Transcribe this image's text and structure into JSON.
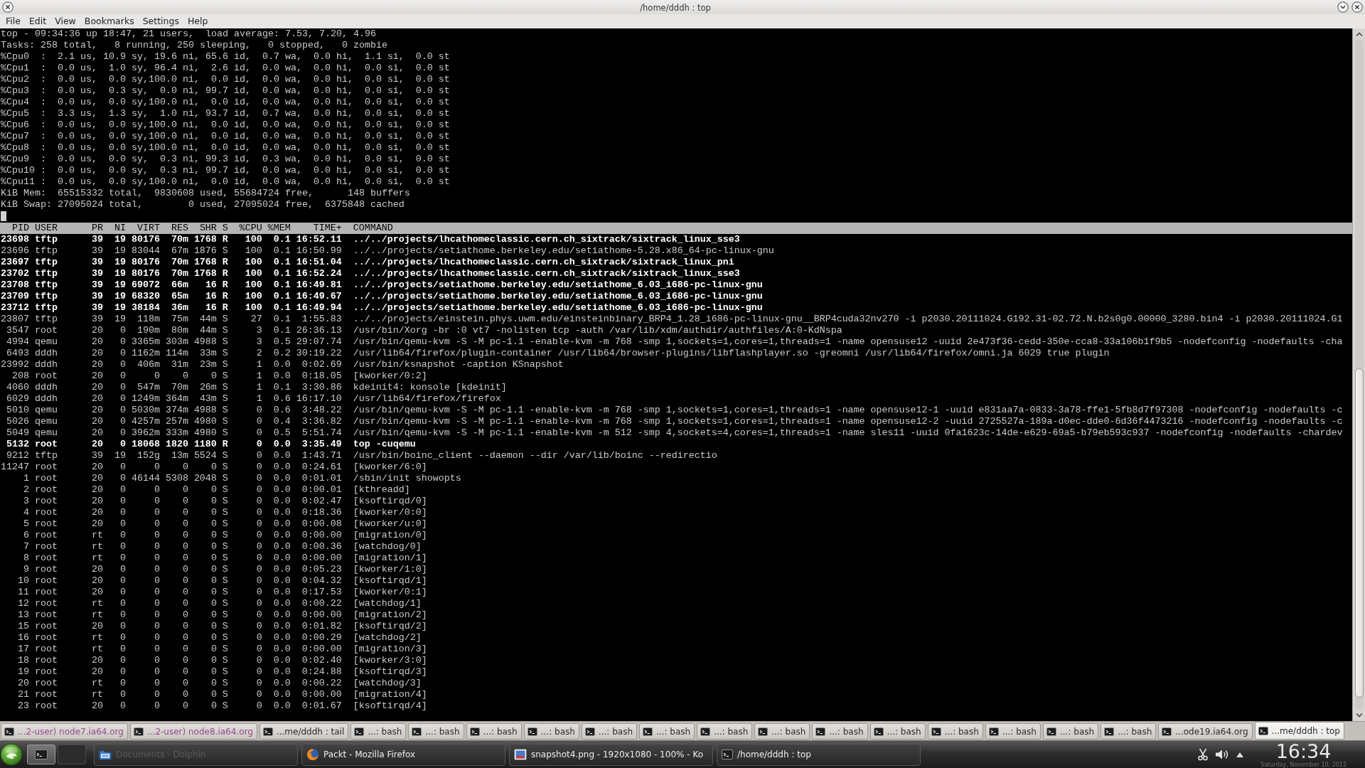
{
  "window": {
    "title": "/home/dddh : top"
  },
  "menu": [
    "File",
    "Edit",
    "View",
    "Bookmarks",
    "Settings",
    "Help"
  ],
  "terminal": {
    "summary": [
      "top - 09:34:36 up 18:47, 21 users,  load average: 7.53, 7.20, 4.96",
      "Tasks: 258 total,   8 running, 250 sleeping,   0 stopped,   0 zombie",
      "%Cpu0  :  2.1 us, 10.9 sy, 19.6 ni, 65.6 id,  0.7 wa,  0.0 hi,  1.1 si,  0.0 st",
      "%Cpu1  :  0.0 us,  1.0 sy, 96.4 ni,  2.6 id,  0.0 wa,  0.0 hi,  0.0 si,  0.0 st",
      "%Cpu2  :  0.0 us,  0.0 sy,100.0 ni,  0.0 id,  0.0 wa,  0.0 hi,  0.0 si,  0.0 st",
      "%Cpu3  :  0.0 us,  0.3 sy,  0.0 ni, 99.7 id,  0.0 wa,  0.0 hi,  0.0 si,  0.0 st",
      "%Cpu4  :  0.0 us,  0.0 sy,100.0 ni,  0.0 id,  0.0 wa,  0.0 hi,  0.0 si,  0.0 st",
      "%Cpu5  :  3.3 us,  1.3 sy,  1.0 ni, 93.7 id,  0.7 wa,  0.0 hi,  0.0 si,  0.0 st",
      "%Cpu6  :  0.0 us,  0.0 sy,100.0 ni,  0.0 id,  0.0 wa,  0.0 hi,  0.0 si,  0.0 st",
      "%Cpu7  :  0.0 us,  0.0 sy,100.0 ni,  0.0 id,  0.0 wa,  0.0 hi,  0.0 si,  0.0 st",
      "%Cpu8  :  0.0 us,  0.0 sy,100.0 ni,  0.0 id,  0.0 wa,  0.0 hi,  0.0 si,  0.0 st",
      "%Cpu9  :  0.0 us,  0.0 sy,  0.3 ni, 99.3 id,  0.3 wa,  0.0 hi,  0.0 si,  0.0 st",
      "%Cpu10 :  0.0 us,  0.0 sy,  0.3 ni, 99.7 id,  0.0 wa,  0.0 hi,  0.0 si,  0.0 st",
      "%Cpu11 :  0.0 us,  0.0 sy,100.0 ni,  0.0 id,  0.0 wa,  0.0 hi,  0.0 si,  0.0 st",
      "KiB Mem:  65515332 total,  9830608 used, 55684724 free,      148 buffers",
      "KiB Swap: 27095024 total,        0 used, 27095024 free,  6375848 cached"
    ],
    "columns": [
      "PID",
      "USER",
      "PR",
      "NI",
      "VIRT",
      "RES",
      "SHR",
      "S",
      "%CPU",
      "%MEM",
      "TIME+",
      "COMMAND"
    ],
    "processes": [
      {
        "pid": "23698",
        "user": "tftp",
        "priority": "39",
        "nice": "19",
        "virt": "80176",
        "res": "70m",
        "shr": "1768",
        "state": "R",
        "cpu": "100",
        "mem": "0.1",
        "time": "16:52.11",
        "command": "../../projects/lhcathomeclassic.cern.ch_sixtrack/sixtrack_linux_sse3",
        "highlighted": true
      },
      {
        "pid": "23696",
        "user": "tftp",
        "priority": "39",
        "nice": "19",
        "virt": "83044",
        "res": "67m",
        "shr": "1876",
        "state": "S",
        "cpu": "100",
        "mem": "0.1",
        "time": "16:50.99",
        "command": "../../projects/setiathome.berkeley.edu/setiathome-5.28.x86_64-pc-linux-gnu",
        "highlighted": false
      },
      {
        "pid": "23697",
        "user": "tftp",
        "priority": "39",
        "nice": "19",
        "virt": "80176",
        "res": "70m",
        "shr": "1768",
        "state": "R",
        "cpu": "100",
        "mem": "0.1",
        "time": "16:51.04",
        "command": "../../projects/lhcathomeclassic.cern.ch_sixtrack/sixtrack_linux_pni",
        "highlighted": true
      },
      {
        "pid": "23702",
        "user": "tftp",
        "priority": "39",
        "nice": "19",
        "virt": "80176",
        "res": "70m",
        "shr": "1768",
        "state": "R",
        "cpu": "100",
        "mem": "0.1",
        "time": "16:52.24",
        "command": "../../projects/lhcathomeclassic.cern.ch_sixtrack/sixtrack_linux_sse3",
        "highlighted": true
      },
      {
        "pid": "23708",
        "user": "tftp",
        "priority": "39",
        "nice": "19",
        "virt": "69072",
        "res": "66m",
        "shr": "16",
        "state": "R",
        "cpu": "100",
        "mem": "0.1",
        "time": "16:49.81",
        "command": "../../projects/setiathome.berkeley.edu/setiathome_6.03_i686-pc-linux-gnu",
        "highlighted": true
      },
      {
        "pid": "23709",
        "user": "tftp",
        "priority": "39",
        "nice": "19",
        "virt": "68320",
        "res": "65m",
        "shr": "16",
        "state": "R",
        "cpu": "100",
        "mem": "0.1",
        "time": "16:49.67",
        "command": "../../projects/setiathome.berkeley.edu/setiathome_6.03_i686-pc-linux-gnu",
        "highlighted": true
      },
      {
        "pid": "23712",
        "user": "tftp",
        "priority": "39",
        "nice": "19",
        "virt": "38184",
        "res": "36m",
        "shr": "16",
        "state": "R",
        "cpu": "100",
        "mem": "0.1",
        "time": "16:49.94",
        "command": "../../projects/setiathome.berkeley.edu/setiathome_6.03_i686-pc-linux-gnu",
        "highlighted": true
      },
      {
        "pid": "23807",
        "user": "tftp",
        "priority": "39",
        "nice": "19",
        "virt": "118m",
        "res": "75m",
        "shr": "44m",
        "state": "S",
        "cpu": "27",
        "mem": "0.1",
        "time": "1:55.83",
        "command": "../../projects/einstein.phys.uwm.edu/einsteinbinary_BRP4_1.28_i686-pc-linux-gnu__BRP4cuda32nv270 -i p2030.20111024.G192.31-02.72.N.b2s0g0.00000_3280.bin4 -i p2030.20111024.G1",
        "highlighted": false
      },
      {
        "pid": "3547",
        "user": "root",
        "priority": "20",
        "nice": "0",
        "virt": "190m",
        "res": "80m",
        "shr": "44m",
        "state": "S",
        "cpu": "3",
        "mem": "0.1",
        "time": "26:36.13",
        "command": "/usr/bin/Xorg -br :0 vt7 -nolisten tcp -auth /var/lib/xdm/authdir/authfiles/A:0-KdNspa",
        "highlighted": false
      },
      {
        "pid": "4994",
        "user": "qemu",
        "priority": "20",
        "nice": "0",
        "virt": "3365m",
        "res": "303m",
        "shr": "4988",
        "state": "S",
        "cpu": "3",
        "mem": "0.5",
        "time": "29:07.74",
        "command": "/usr/bin/qemu-kvm -S -M pc-1.1 -enable-kvm -m 768 -smp 1,sockets=1,cores=1,threads=1 -name opensuse12 -uuid 2e473f36-cedd-350e-cca8-33a106b1f9b5 -nodefconfig -nodefaults -cha",
        "highlighted": false
      },
      {
        "pid": "6493",
        "user": "dddh",
        "priority": "20",
        "nice": "0",
        "virt": "1162m",
        "res": "114m",
        "shr": "33m",
        "state": "S",
        "cpu": "2",
        "mem": "0.2",
        "time": "30:19.22",
        "command": "/usr/lib64/firefox/plugin-container /usr/lib64/browser-plugins/libflashplayer.so -greomni /usr/lib64/firefox/omni.ja 6029 true plugin",
        "highlighted": false
      },
      {
        "pid": "23992",
        "user": "dddh",
        "priority": "20",
        "nice": "0",
        "virt": "406m",
        "res": "31m",
        "shr": "23m",
        "state": "S",
        "cpu": "1",
        "mem": "0.0",
        "time": "0:02.69",
        "command": "/usr/bin/ksnapshot -caption KSnapshot",
        "highlighted": false
      },
      {
        "pid": "208",
        "user": "root",
        "priority": "20",
        "nice": "0",
        "virt": "0",
        "res": "0",
        "shr": "0",
        "state": "S",
        "cpu": "1",
        "mem": "0.0",
        "time": "0:18.05",
        "command": "[kworker/0:2]",
        "highlighted": false
      },
      {
        "pid": "4060",
        "user": "dddh",
        "priority": "20",
        "nice": "0",
        "virt": "547m",
        "res": "70m",
        "shr": "26m",
        "state": "S",
        "cpu": "1",
        "mem": "0.1",
        "time": "3:30.86",
        "command": "kdeinit4: konsole [kdeinit]",
        "highlighted": false
      },
      {
        "pid": "6029",
        "user": "dddh",
        "priority": "20",
        "nice": "0",
        "virt": "1249m",
        "res": "364m",
        "shr": "43m",
        "state": "S",
        "cpu": "1",
        "mem": "0.6",
        "time": "16:17.10",
        "command": "/usr/lib64/firefox/firefox",
        "highlighted": false
      },
      {
        "pid": "5010",
        "user": "qemu",
        "priority": "20",
        "nice": "0",
        "virt": "5030m",
        "res": "374m",
        "shr": "4988",
        "state": "S",
        "cpu": "0",
        "mem": "0.6",
        "time": "3:48.22",
        "command": "/usr/bin/qemu-kvm -S -M pc-1.1 -enable-kvm -m 768 -smp 1,sockets=1,cores=1,threads=1 -name opensuse12-1 -uuid e831aa7a-0833-3a78-ffe1-5fb8d7f97308 -nodefconfig -nodefaults -c",
        "highlighted": false
      },
      {
        "pid": "5026",
        "user": "qemu",
        "priority": "20",
        "nice": "0",
        "virt": "4257m",
        "res": "257m",
        "shr": "4980",
        "state": "S",
        "cpu": "0",
        "mem": "0.4",
        "time": "3:36.82",
        "command": "/usr/bin/qemu-kvm -S -M pc-1.1 -enable-kvm -m 768 -smp 1,sockets=1,cores=1,threads=1 -name opensuse12-2 -uuid 2725527a-189a-d0ec-dde0-6d36f4473216 -nodefconfig -nodefaults -c",
        "highlighted": false
      },
      {
        "pid": "5049",
        "user": "qemu",
        "priority": "20",
        "nice": "0",
        "virt": "3962m",
        "res": "333m",
        "shr": "4980",
        "state": "S",
        "cpu": "0",
        "mem": "0.5",
        "time": "5:51.74",
        "command": "/usr/bin/qemu-kvm -S -M pc-1.1 -enable-kvm -m 512 -smp 4,sockets=4,cores=1,threads=1 -name sles11 -uuid 0fa1623c-14de-e629-69a5-b79eb593c937 -nodefconfig -nodefaults -chardev",
        "highlighted": false
      },
      {
        "pid": "5132",
        "user": "root",
        "priority": "20",
        "nice": "0",
        "virt": "18068",
        "res": "1820",
        "shr": "1180",
        "state": "R",
        "cpu": "0",
        "mem": "0.0",
        "time": "3:35.49",
        "command": "top -cuqemu",
        "highlighted": true
      },
      {
        "pid": "9212",
        "user": "tftp",
        "priority": "39",
        "nice": "19",
        "virt": "152g",
        "res": "13m",
        "shr": "5524",
        "state": "S",
        "cpu": "0",
        "mem": "0.0",
        "time": "1:43.71",
        "command": "/usr/bin/boinc_client --daemon --dir /var/lib/boinc --redirectio",
        "highlighted": false
      },
      {
        "pid": "11247",
        "user": "root",
        "priority": "20",
        "nice": "0",
        "virt": "0",
        "res": "0",
        "shr": "0",
        "state": "S",
        "cpu": "0",
        "mem": "0.0",
        "time": "0:24.61",
        "command": "[kworker/6:0]",
        "highlighted": false
      },
      {
        "pid": "1",
        "user": "root",
        "priority": "20",
        "nice": "0",
        "virt": "46144",
        "res": "5308",
        "shr": "2048",
        "state": "S",
        "cpu": "0",
        "mem": "0.0",
        "time": "0:01.01",
        "command": "/sbin/init showopts",
        "highlighted": false
      },
      {
        "pid": "2",
        "user": "root",
        "priority": "20",
        "nice": "0",
        "virt": "0",
        "res": "0",
        "shr": "0",
        "state": "S",
        "cpu": "0",
        "mem": "0.0",
        "time": "0:00.01",
        "command": "[kthreadd]",
        "highlighted": false
      },
      {
        "pid": "3",
        "user": "root",
        "priority": "20",
        "nice": "0",
        "virt": "0",
        "res": "0",
        "shr": "0",
        "state": "S",
        "cpu": "0",
        "mem": "0.0",
        "time": "0:02.47",
        "command": "[ksoftirqd/0]",
        "highlighted": false
      },
      {
        "pid": "4",
        "user": "root",
        "priority": "20",
        "nice": "0",
        "virt": "0",
        "res": "0",
        "shr": "0",
        "state": "S",
        "cpu": "0",
        "mem": "0.0",
        "time": "0:18.36",
        "command": "[kworker/0:0]",
        "highlighted": false
      },
      {
        "pid": "5",
        "user": "root",
        "priority": "20",
        "nice": "0",
        "virt": "0",
        "res": "0",
        "shr": "0",
        "state": "S",
        "cpu": "0",
        "mem": "0.0",
        "time": "0:00.08",
        "command": "[kworker/u:0]",
        "highlighted": false
      },
      {
        "pid": "6",
        "user": "root",
        "priority": "rt",
        "nice": "0",
        "virt": "0",
        "res": "0",
        "shr": "0",
        "state": "S",
        "cpu": "0",
        "mem": "0.0",
        "time": "0:00.00",
        "command": "[migration/0]",
        "highlighted": false
      },
      {
        "pid": "7",
        "user": "root",
        "priority": "rt",
        "nice": "0",
        "virt": "0",
        "res": "0",
        "shr": "0",
        "state": "S",
        "cpu": "0",
        "mem": "0.0",
        "time": "0:00.36",
        "command": "[watchdog/0]",
        "highlighted": false
      },
      {
        "pid": "8",
        "user": "root",
        "priority": "rt",
        "nice": "0",
        "virt": "0",
        "res": "0",
        "shr": "0",
        "state": "S",
        "cpu": "0",
        "mem": "0.0",
        "time": "0:00.00",
        "command": "[migration/1]",
        "highlighted": false
      },
      {
        "pid": "9",
        "user": "root",
        "priority": "20",
        "nice": "0",
        "virt": "0",
        "res": "0",
        "shr": "0",
        "state": "S",
        "cpu": "0",
        "mem": "0.0",
        "time": "0:05.23",
        "command": "[kworker/1:0]",
        "highlighted": false
      },
      {
        "pid": "10",
        "user": "root",
        "priority": "20",
        "nice": "0",
        "virt": "0",
        "res": "0",
        "shr": "0",
        "state": "S",
        "cpu": "0",
        "mem": "0.0",
        "time": "0:04.32",
        "command": "[ksoftirqd/1]",
        "highlighted": false
      },
      {
        "pid": "11",
        "user": "root",
        "priority": "20",
        "nice": "0",
        "virt": "0",
        "res": "0",
        "shr": "0",
        "state": "S",
        "cpu": "0",
        "mem": "0.0",
        "time": "0:17.53",
        "command": "[kworker/0:1]",
        "highlighted": false
      },
      {
        "pid": "12",
        "user": "root",
        "priority": "rt",
        "nice": "0",
        "virt": "0",
        "res": "0",
        "shr": "0",
        "state": "S",
        "cpu": "0",
        "mem": "0.0",
        "time": "0:00.22",
        "command": "[watchdog/1]",
        "highlighted": false
      },
      {
        "pid": "13",
        "user": "root",
        "priority": "rt",
        "nice": "0",
        "virt": "0",
        "res": "0",
        "shr": "0",
        "state": "S",
        "cpu": "0",
        "mem": "0.0",
        "time": "0:00.00",
        "command": "[migration/2]",
        "highlighted": false
      },
      {
        "pid": "15",
        "user": "root",
        "priority": "20",
        "nice": "0",
        "virt": "0",
        "res": "0",
        "shr": "0",
        "state": "S",
        "cpu": "0",
        "mem": "0.0",
        "time": "0:01.82",
        "command": "[ksoftirqd/2]",
        "highlighted": false
      },
      {
        "pid": "16",
        "user": "root",
        "priority": "rt",
        "nice": "0",
        "virt": "0",
        "res": "0",
        "shr": "0",
        "state": "S",
        "cpu": "0",
        "mem": "0.0",
        "time": "0:00.29",
        "command": "[watchdog/2]",
        "highlighted": false
      },
      {
        "pid": "17",
        "user": "root",
        "priority": "rt",
        "nice": "0",
        "virt": "0",
        "res": "0",
        "shr": "0",
        "state": "S",
        "cpu": "0",
        "mem": "0.0",
        "time": "0:00.00",
        "command": "[migration/3]",
        "highlighted": false
      },
      {
        "pid": "18",
        "user": "root",
        "priority": "20",
        "nice": "0",
        "virt": "0",
        "res": "0",
        "shr": "0",
        "state": "S",
        "cpu": "0",
        "mem": "0.0",
        "time": "0:02.40",
        "command": "[kworker/3:0]",
        "highlighted": false
      },
      {
        "pid": "19",
        "user": "root",
        "priority": "20",
        "nice": "0",
        "virt": "0",
        "res": "0",
        "shr": "0",
        "state": "S",
        "cpu": "0",
        "mem": "0.0",
        "time": "0:24.88",
        "command": "[ksoftirqd/3]",
        "highlighted": false
      },
      {
        "pid": "20",
        "user": "root",
        "priority": "rt",
        "nice": "0",
        "virt": "0",
        "res": "0",
        "shr": "0",
        "state": "S",
        "cpu": "0",
        "mem": "0.0",
        "time": "0:00.22",
        "command": "[watchdog/3]",
        "highlighted": false
      },
      {
        "pid": "21",
        "user": "root",
        "priority": "rt",
        "nice": "0",
        "virt": "0",
        "res": "0",
        "shr": "0",
        "state": "S",
        "cpu": "0",
        "mem": "0.0",
        "time": "0:00.00",
        "command": "[migration/4]",
        "highlighted": false
      },
      {
        "pid": "23",
        "user": "root",
        "priority": "20",
        "nice": "0",
        "virt": "0",
        "res": "0",
        "shr": "0",
        "state": "S",
        "cpu": "0",
        "mem": "0.0",
        "time": "0:01.67",
        "command": "[ksoftirqd/4]",
        "highlighted": false
      }
    ]
  },
  "tabs": [
    {
      "label": "...2-user) node7.ia64.org",
      "activity": true,
      "selected": false
    },
    {
      "label": "...2-user) node8.ia64.org",
      "activity": true,
      "selected": false
    },
    {
      "label": "...me/dddh : tail",
      "activity": false,
      "selected": false
    },
    {
      "label": "...: bash",
      "activity": false,
      "selected": false
    },
    {
      "label": "...: bash",
      "activity": false,
      "selected": false
    },
    {
      "label": "...: bash",
      "activity": false,
      "selected": false
    },
    {
      "label": "...: bash",
      "activity": false,
      "selected": false
    },
    {
      "label": "...: bash",
      "activity": false,
      "selected": false
    },
    {
      "label": "...: bash",
      "activity": false,
      "selected": false
    },
    {
      "label": "...: bash",
      "activity": false,
      "selected": false
    },
    {
      "label": "...: bash",
      "activity": false,
      "selected": false
    },
    {
      "label": "...: bash",
      "activity": false,
      "selected": false
    },
    {
      "label": "...: bash",
      "activity": false,
      "selected": false
    },
    {
      "label": "...: bash",
      "activity": false,
      "selected": false
    },
    {
      "label": "...: bash",
      "activity": false,
      "selected": false
    },
    {
      "label": "...: bash",
      "activity": false,
      "selected": false
    },
    {
      "label": "...: bash",
      "activity": false,
      "selected": false
    },
    {
      "label": "...ode19.ia64.org",
      "activity": false,
      "selected": false
    },
    {
      "label": "...me/dddh : top",
      "activity": false,
      "selected": true
    }
  ],
  "taskbar": {
    "pager": [
      {
        "selected": true,
        "occupied": true
      },
      {
        "selected": false,
        "occupied": false
      }
    ],
    "tasks": [
      {
        "label": "Documents - Dolphin",
        "kind": "filemanager",
        "minimized": true
      },
      {
        "label": "Packt - Mozilla Firefox",
        "kind": "browser",
        "minimized": false
      },
      {
        "label": "snapshot4.png - 1920x1080 - 100% - Ko",
        "kind": "viewer",
        "minimized": false
      },
      {
        "label": "/home/dddh : top",
        "kind": "terminal",
        "minimized": false
      }
    ],
    "clock": {
      "time": "16:34",
      "date": "Saturday, November 10, 2012"
    }
  }
}
